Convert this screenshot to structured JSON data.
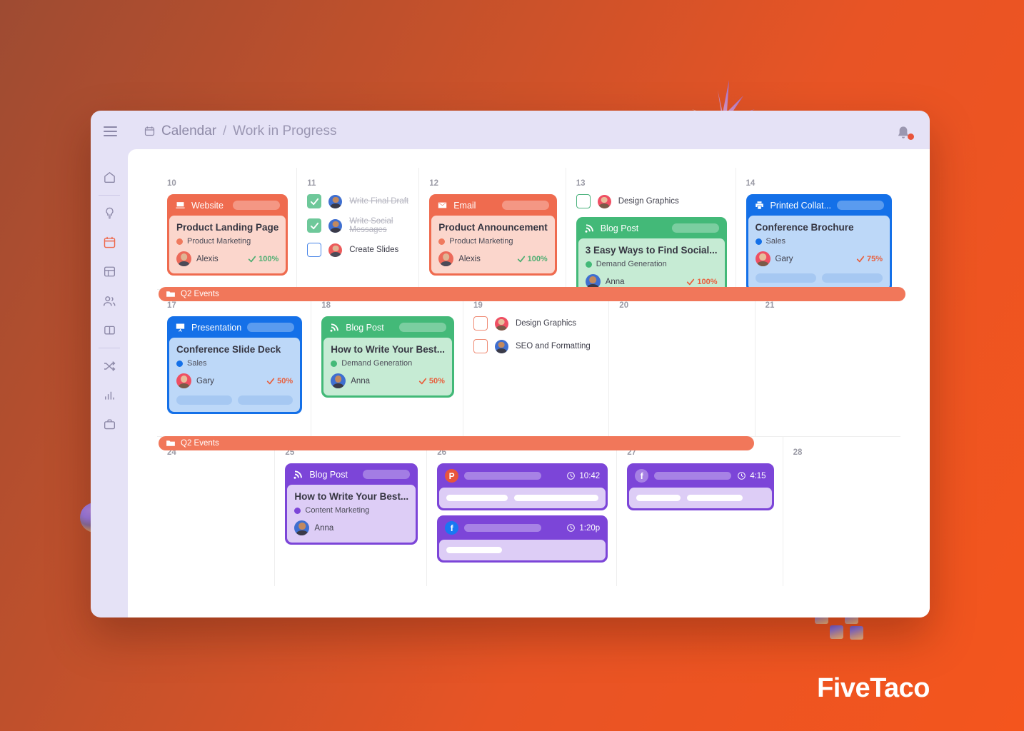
{
  "brand": {
    "name": "FiveTaco"
  },
  "header": {
    "menu_icon": "hamburger-icon",
    "calendar_icon": "calendar-icon",
    "crumb_1": "Calendar",
    "separator": "/",
    "crumb_2": "Work in Progress",
    "bell_icon": "bell-icon",
    "has_notification": true
  },
  "sidebar": {
    "items": [
      {
        "icon": "home-icon",
        "active": false
      },
      {
        "icon": "lightbulb-icon",
        "active": false
      },
      {
        "icon": "calendar-icon",
        "active": true
      },
      {
        "icon": "dashboard-icon",
        "active": false
      },
      {
        "icon": "people-icon",
        "active": false
      },
      {
        "icon": "book-icon",
        "active": false
      },
      {
        "icon": "shuffle-icon",
        "active": false
      },
      {
        "icon": "bar-chart-icon",
        "active": false
      },
      {
        "icon": "briefcase-icon",
        "active": false
      }
    ],
    "active_color": "#ee6a4d",
    "idle_color": "#8b87a6"
  },
  "colors": {
    "orange": "#ef6b4f",
    "green": "#43b978",
    "blue": "#1470e8",
    "purple": "#7c45d8",
    "check_green": "#4fae73",
    "check_orange": "#e8603e"
  },
  "banners": [
    {
      "label": "Q2 Events",
      "icon": "folder-icon"
    },
    {
      "label": "Q2 Events",
      "icon": "folder-icon"
    }
  ],
  "weeks": [
    {
      "days": [
        {
          "num": "10",
          "card": {
            "theme": "orange",
            "type_icon": "monitor-icon",
            "type": "Website",
            "title": "Product Landing Page",
            "tag": "Product Marketing",
            "tag_color": "#ef7a5e",
            "assignee": "Alexis",
            "avatar": "av-alexis",
            "percent": "100%",
            "percent_color": "#4fae73",
            "bars": 0
          }
        },
        {
          "num": "11",
          "checks": [
            {
              "label": "Write Final Draft",
              "state": "done",
              "avatar": "av-anna"
            },
            {
              "label": "Write Social Messages",
              "state": "done",
              "avatar": "av-anna"
            },
            {
              "label": "Create Slides",
              "state": "todo-blue",
              "avatar": "av-mike"
            }
          ]
        },
        {
          "num": "12",
          "card": {
            "theme": "orange",
            "type_icon": "envelope-icon",
            "type": "Email",
            "title": "Product Announcement",
            "tag": "Product Marketing",
            "tag_color": "#ef7a5e",
            "assignee": "Alexis",
            "avatar": "av-alexis",
            "percent": "100%",
            "percent_color": "#4fae73",
            "bars": 0
          }
        },
        {
          "num": "13",
          "checks": [
            {
              "label": "Design Graphics",
              "state": "todo-green",
              "avatar": "av-gary"
            }
          ],
          "card": {
            "theme": "green",
            "type_icon": "rss-icon",
            "type": "Blog Post",
            "title": "3 Easy Ways to Find Social...",
            "tag": "Demand Generation",
            "tag_color": "#43b978",
            "assignee": "Anna",
            "avatar": "av-anna",
            "percent": "100%",
            "percent_color": "#e8603e",
            "bars": 0
          }
        },
        {
          "num": "14",
          "card": {
            "theme": "blue",
            "type_icon": "printer-icon",
            "type": "Printed Collat...",
            "title": "Conference Brochure",
            "tag": "Sales",
            "tag_color": "#1470e8",
            "assignee": "Gary",
            "avatar": "av-gary",
            "percent": "75%",
            "percent_color": "#e8603e",
            "bars": 2
          }
        }
      ]
    },
    {
      "days": [
        {
          "num": "17",
          "card": {
            "theme": "blue",
            "type_icon": "presentation-icon",
            "type": "Presentation",
            "title": "Conference Slide Deck",
            "tag": "Sales",
            "tag_color": "#1470e8",
            "assignee": "Gary",
            "avatar": "av-gary",
            "percent": "50%",
            "percent_color": "#e8603e",
            "bars": 2
          }
        },
        {
          "num": "18",
          "card": {
            "theme": "green",
            "type_icon": "rss-icon",
            "type": "Blog Post",
            "title": "How to Write Your Best...",
            "tag": "Demand Generation",
            "tag_color": "#43b978",
            "assignee": "Anna",
            "avatar": "av-anna",
            "percent": "50%",
            "percent_color": "#e8603e",
            "bars": 0
          }
        },
        {
          "num": "19",
          "checks": [
            {
              "label": "Design Graphics",
              "state": "todo-orange",
              "avatar": "av-gary"
            },
            {
              "label": "SEO and Formatting",
              "state": "todo-orange",
              "avatar": "av-anna"
            }
          ]
        },
        {
          "num": "20"
        },
        {
          "num": "21"
        }
      ]
    },
    {
      "days": [
        {
          "num": "24"
        },
        {
          "num": "25",
          "card": {
            "theme": "purple",
            "type_icon": "rss-icon",
            "type": "Blog Post",
            "title": "How to Write Your Best...",
            "tag": "Content Marketing",
            "tag_color": "#7c45d8",
            "assignee": "Anna",
            "avatar": "av-anna",
            "percent": "",
            "percent_color": "#e8603e",
            "bars": 0
          }
        },
        {
          "num": "26",
          "social": [
            {
              "network": "pinterest",
              "icon": "pinterest-icon",
              "time": "10:42",
              "clock_icon": "clock-icon",
              "lines": [
                86,
                118
              ]
            },
            {
              "network": "facebook",
              "icon": "facebook-icon",
              "time": "1:20p",
              "clock_icon": "clock-icon",
              "lines": [
                78
              ]
            }
          ]
        },
        {
          "num": "27",
          "social": [
            {
              "network": "facebook-flat",
              "icon": "facebook-icon",
              "time": "4:15",
              "clock_icon": "clock-icon",
              "lines": [
                62,
                78
              ]
            }
          ]
        },
        {
          "num": "28"
        }
      ]
    }
  ]
}
